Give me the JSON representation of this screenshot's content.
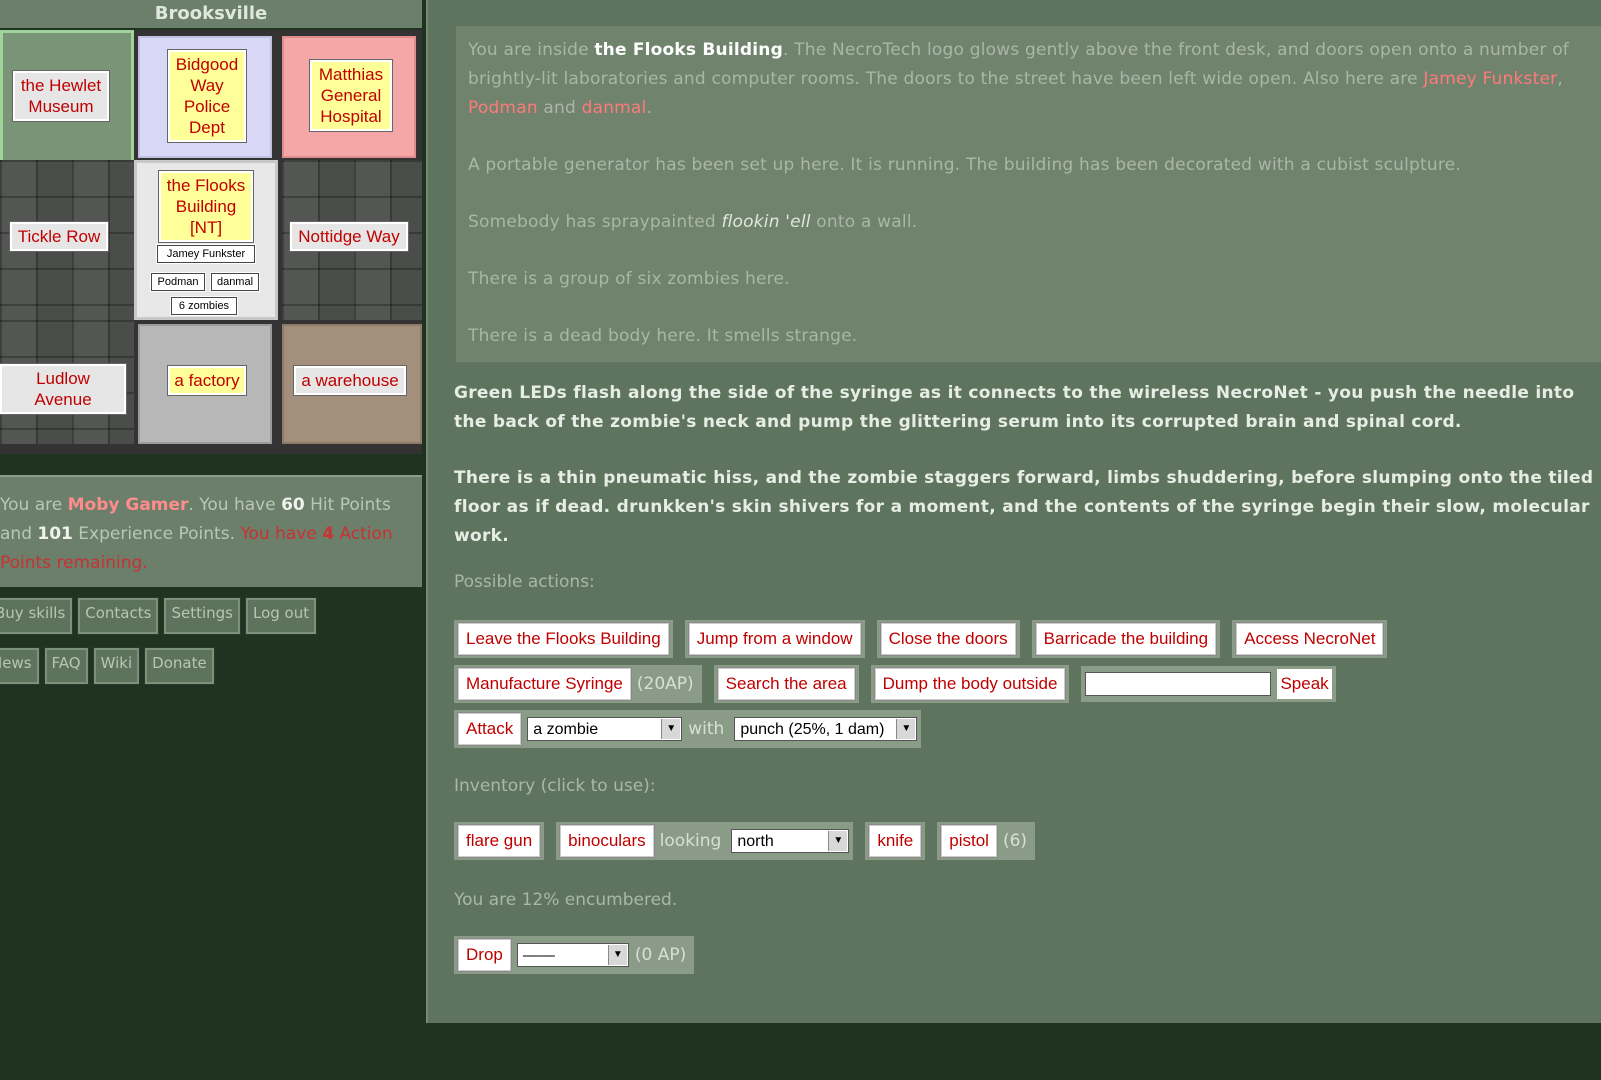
{
  "suburb": "Brooksville",
  "map": {
    "top_left": "the Hewlet Museum",
    "top_mid": "Bidgood Way Police Dept",
    "top_right": "Matthias General Hospital",
    "mid_left": "Tickle Row",
    "current": "the Flooks Building [NT]",
    "mid_right": "Nottidge Way",
    "bot_left": "Ludlow Avenue",
    "bot_mid": "a factory",
    "bot_right": "a warehouse",
    "occupants": [
      "Jamey Funkster",
      "Podman",
      "danmal",
      "6 zombies"
    ]
  },
  "status": {
    "p1": "You are ",
    "name": "Moby Gamer",
    "p2": ". You have ",
    "hp": "60",
    "p3": " Hit Points and ",
    "xp": "101",
    "p4": " Experience Points.",
    "p5": "You have ",
    "ap": "4",
    "p6": " Action Points remaining."
  },
  "nav": {
    "row1": [
      "Buy skills",
      "Contacts",
      "Settings",
      "Log out"
    ],
    "row2": [
      "News",
      "FAQ",
      "Wiki",
      "Donate"
    ]
  },
  "description": {
    "p1a": "You are inside ",
    "building": "the Flooks Building",
    "p1b": ". The NecroTech logo glows gently above the front desk, and doors open onto a number of brightly-lit laboratories and computer rooms. The doors to the street have been left wide open. Also here are ",
    "player1": "Jamey Funkster",
    "sep1": ", ",
    "player2": "Podman",
    "sep2": " and ",
    "player3": "danmal",
    "end": ".",
    "p2": "A portable generator has been set up here. It is running. The building has been decorated with a cubist sculpture.",
    "p3a": "Somebody has spraypainted ",
    "graffiti": "flookin 'ell",
    "p3b": " onto a wall.",
    "p4": "There is a group of six zombies here.",
    "p5": "There is a dead body here. It smells strange."
  },
  "messages": {
    "m1": "Green LEDs flash along the side of the syringe as it connects to the wireless NecroNet - you push the needle into the back of the zombie's neck and pump the glittering serum into its corrupted brain and spinal cord.",
    "m2": "There is a thin pneumatic hiss, and the zombie staggers forward, limbs shuddering, before slumping onto the tiled floor as if dead. drunkken's skin shivers for a moment, and the contents of the syringe begin their slow, molecular work."
  },
  "actions": {
    "label": "Possible actions:",
    "leave": "Leave the Flooks Building",
    "jump": "Jump from a window",
    "close": "Close the doors",
    "barricade": "Barricade the building",
    "necronet": "Access NecroNet",
    "manufacture": "Manufacture Syringe",
    "manufacture_cost": "(20AP)",
    "search": "Search the area",
    "dump": "Dump the body outside",
    "speak": "Speak",
    "speak_value": "",
    "attack": "Attack",
    "attack_target": "a zombie",
    "with": "with",
    "weapon": "punch (25%, 1 dam)"
  },
  "inventory": {
    "label": "Inventory (click to use):",
    "flare": "flare gun",
    "binoculars": "binoculars",
    "looking": "looking",
    "direction": "north",
    "knife": "knife",
    "pistol": "pistol",
    "pistol_ammo": "(6)",
    "encumbered": "You are 12% encumbered.",
    "drop": "Drop",
    "drop_item": "——",
    "drop_cost": "(0 AP)"
  }
}
